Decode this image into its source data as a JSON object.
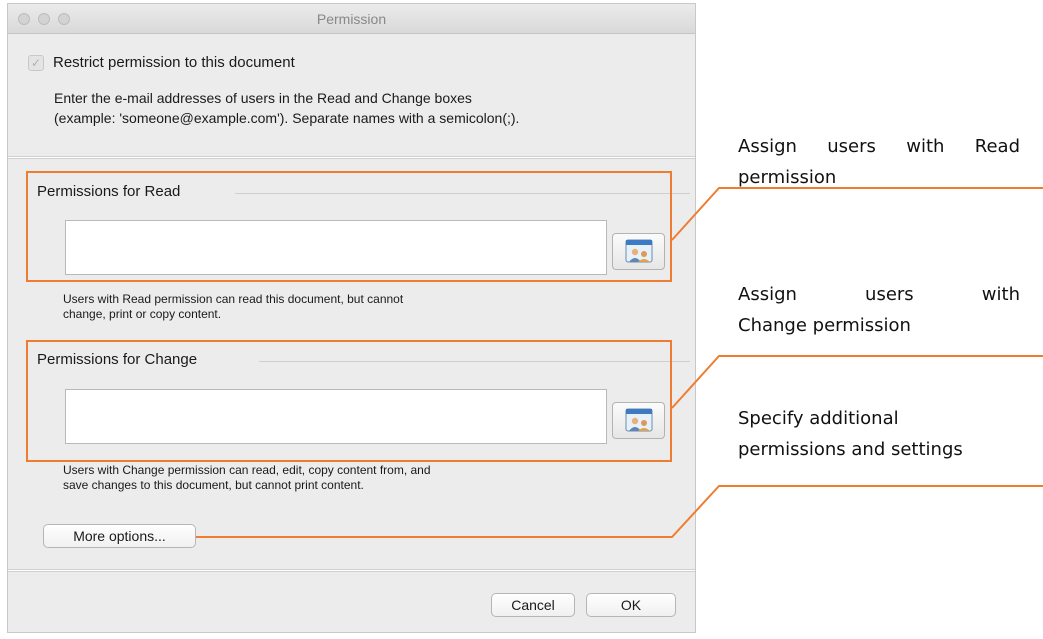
{
  "window": {
    "title": "Permission"
  },
  "restrict": {
    "label": "Restrict permission to this document",
    "checked": true
  },
  "instructions": {
    "line1": "Enter the e-mail addresses of users in the Read and Change boxes",
    "line2": "(example: 'someone@example.com'). Separate names with a semicolon(;)."
  },
  "read_group": {
    "title": "Permissions for Read",
    "value": "",
    "help_line1": "Users with Read permission can read this document, but cannot",
    "help_line2": "change, print or copy content."
  },
  "change_group": {
    "title": "Permissions for Change",
    "value": "",
    "help_line1": "Users with Change permission can read, edit, copy content from, and",
    "help_line2": "save changes to this document, but cannot print content."
  },
  "buttons": {
    "more_options": "More options...",
    "cancel": "Cancel",
    "ok": "OK"
  },
  "callouts": {
    "read": {
      "line1": "Assign users with Read",
      "line2": "permission"
    },
    "change": {
      "line1": "Assign users with",
      "line2": "Change permission"
    },
    "more": {
      "line1": "Specify additional",
      "line2": "permissions and settings"
    }
  },
  "colors": {
    "highlight": "#ee7d32",
    "dialog_bg": "#ececec"
  }
}
